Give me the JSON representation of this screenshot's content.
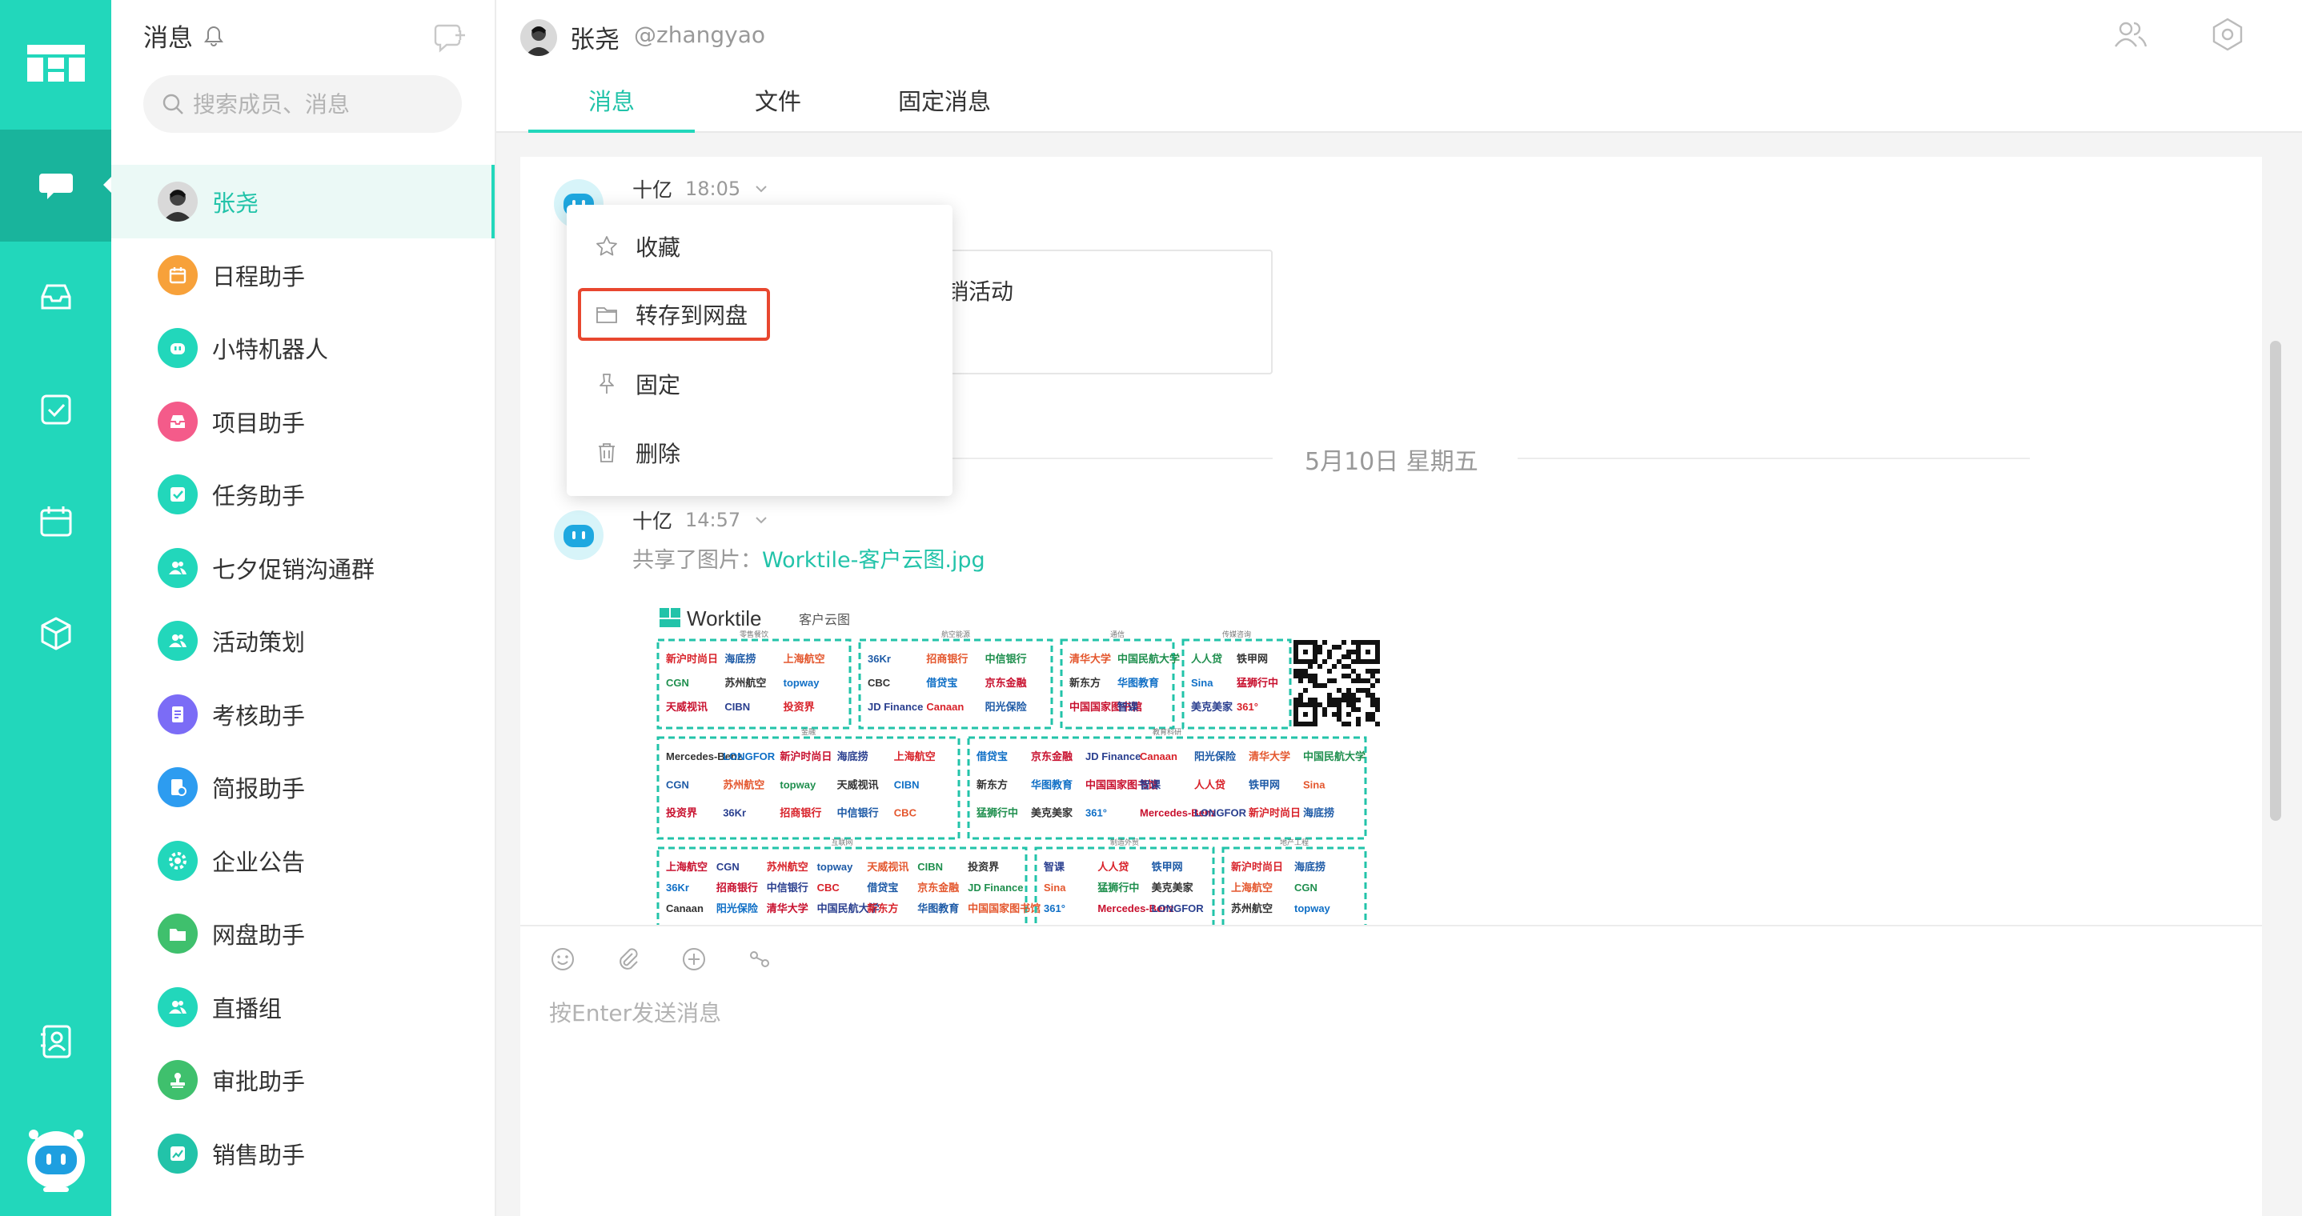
{
  "app": {
    "brand_color": "#22d7bb",
    "active_color": "#19b49c",
    "accent_text_color": "#22c3a9"
  },
  "rail": {
    "items": [
      {
        "icon": "message-icon",
        "active": true
      },
      {
        "icon": "inbox-icon",
        "active": false
      },
      {
        "icon": "task-icon",
        "active": false
      },
      {
        "icon": "calendar-icon",
        "active": false
      },
      {
        "icon": "cube-icon",
        "active": false
      },
      {
        "icon": "contacts-icon",
        "active": false
      }
    ],
    "bottom_icon": "robot-avatar-icon"
  },
  "sidebar": {
    "title": "消息",
    "search_placeholder": "搜索成员、消息",
    "sessions": [
      {
        "name": "张尧",
        "icon": "user-photo",
        "color": "#555555",
        "active": true
      },
      {
        "name": "日程助手",
        "icon": "calendar-icon",
        "color": "#f7a13a"
      },
      {
        "name": "小特机器人",
        "icon": "robot-icon",
        "color": "#22d7bb"
      },
      {
        "name": "项目助手",
        "icon": "inbox-icon",
        "color": "#f45b8a"
      },
      {
        "name": "任务助手",
        "icon": "check-icon",
        "color": "#22d7bb"
      },
      {
        "name": "七夕促销沟通群",
        "icon": "group-icon",
        "color": "#22d7bb"
      },
      {
        "name": "活动策划",
        "icon": "group-icon",
        "color": "#22d7bb"
      },
      {
        "name": "考核助手",
        "icon": "doc-icon",
        "color": "#7b6cf6"
      },
      {
        "name": "简报助手",
        "icon": "report-icon",
        "color": "#2d9cf0"
      },
      {
        "name": "企业公告",
        "icon": "gear-icon",
        "color": "#22d7bb"
      },
      {
        "name": "网盘助手",
        "icon": "folder-icon",
        "color": "#3fc06d"
      },
      {
        "name": "直播组",
        "icon": "group-icon",
        "color": "#22d7bb"
      },
      {
        "name": "审批助手",
        "icon": "stamp-icon",
        "color": "#3fc06d"
      },
      {
        "name": "销售助手",
        "icon": "chart-icon",
        "color": "#22c3a9"
      }
    ]
  },
  "header": {
    "name": "张尧",
    "handle": "@zhangyao",
    "tabs": [
      {
        "label": "消息",
        "active": true
      },
      {
        "label": "文件",
        "active": false
      },
      {
        "label": "固定消息",
        "active": false
      }
    ]
  },
  "messages": [
    {
      "sender": "十亿",
      "time": "18:05",
      "card_text": "销活动"
    },
    {
      "sender": "十亿",
      "time": "14:57",
      "share_prefix": "共享了图片：",
      "share_link": "Worktile-客户云图.jpg"
    }
  ],
  "date_divider": "5月10日 星期五",
  "context_menu": {
    "items": [
      {
        "label": "收藏",
        "icon": "star-icon"
      },
      {
        "label": "转存到网盘",
        "icon": "folder-icon",
        "highlighted": true
      },
      {
        "label": "固定",
        "icon": "pin-icon"
      },
      {
        "label": "删除",
        "icon": "trash-icon"
      }
    ]
  },
  "image_preview": {
    "brand": "Worktile",
    "caption": "客户云图",
    "section_labels": [
      "零售餐饮",
      "航空能源",
      "通信",
      "传媒咨询",
      "金融",
      "教育科研",
      "互联网",
      "制造外贸",
      "地产工程"
    ],
    "logos": [
      "新沪时尚日",
      "海底捞",
      "上海航空",
      "CGN",
      "苏州航空",
      "topway",
      "天威视讯",
      "CIBN",
      "投资界",
      "36Kr",
      "招商银行",
      "中信银行",
      "CBC",
      "借贷宝",
      "京东金融",
      "JD Finance",
      "Canaan",
      "阳光保险",
      "清华大学",
      "中国民航大学",
      "新东方",
      "华图教育",
      "中国国家图书馆",
      "智课",
      "人人贷",
      "铁甲网",
      "Sina",
      "猛狮行中",
      "美克美家",
      "361°",
      "Mercedes-Benz",
      "LONGFOR"
    ]
  },
  "composer": {
    "placeholder": "按Enter发送消息"
  }
}
